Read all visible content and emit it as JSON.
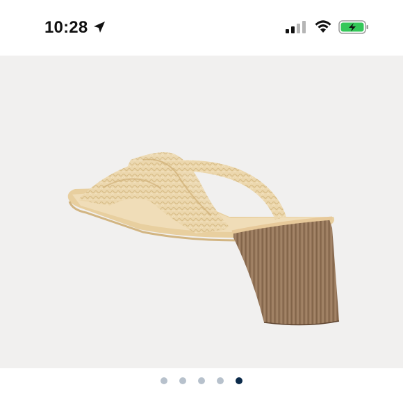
{
  "status_bar": {
    "time": "10:28",
    "icons": [
      "location-arrow-icon",
      "cellular-signal-icon",
      "wifi-icon",
      "battery-charging-icon"
    ],
    "battery_color": "#34c759"
  },
  "product": {
    "image_description_icon": "raffia-slide-sandal-image",
    "background_color": "#f1f0ef"
  },
  "carousel": {
    "total": 5,
    "active_index": 4,
    "active_color": "#0b2a4a",
    "inactive_color": "#b7c1cc"
  }
}
